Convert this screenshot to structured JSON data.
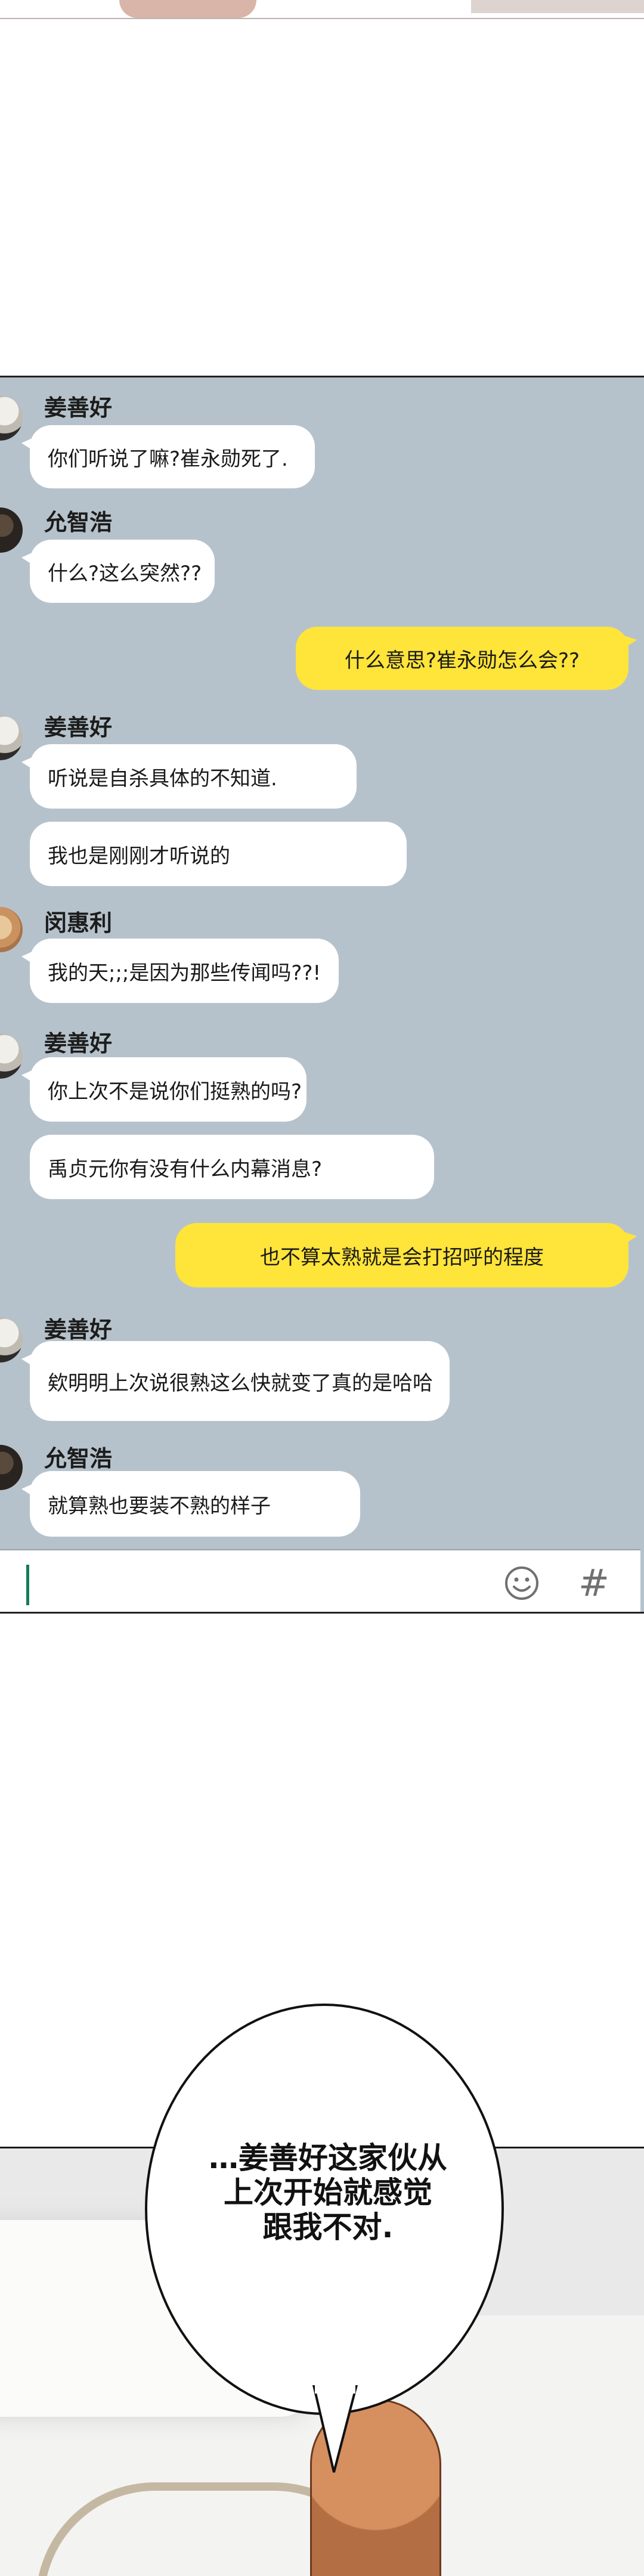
{
  "chat": {
    "messages": [
      {
        "sender": "姜善好",
        "texts": [
          "你们听说了嘛?崔永勋死了."
        ]
      },
      {
        "sender": "允智浩",
        "texts": [
          "什么?这么突然??"
        ]
      },
      {
        "mine": true,
        "texts": [
          "什么意思?崔永勋怎么会??"
        ]
      },
      {
        "sender": "姜善好",
        "texts": [
          "听说是自杀具体的不知道.",
          "我也是刚刚才听说的"
        ]
      },
      {
        "sender": "闵惠利",
        "texts": [
          "我的天;;;是因为那些传闻吗??!"
        ]
      },
      {
        "sender": "姜善好",
        "texts": [
          "你上次不是说你们挺熟的吗?",
          "禹贞元你有没有什么内幕消息?"
        ]
      },
      {
        "mine": true,
        "texts": [
          "也不算太熟就是会打招呼的程度"
        ]
      },
      {
        "sender": "姜善好",
        "texts": [
          "欸明明上次说很熟这么快就变了真的是哈哈"
        ]
      },
      {
        "sender": "允智浩",
        "texts": [
          "就算熟也要装不熟的样子"
        ]
      }
    ],
    "input_value": "",
    "icons": [
      "emoji-icon",
      "hash-icon"
    ],
    "colors": {
      "background": "#b6c2cb",
      "mine_bubble": "#ffe43a",
      "other_bubble": "#ffffff"
    }
  },
  "speech": {
    "lines": [
      "…姜善好这家伙从",
      "上次开始就感觉",
      "跟我不对."
    ]
  }
}
